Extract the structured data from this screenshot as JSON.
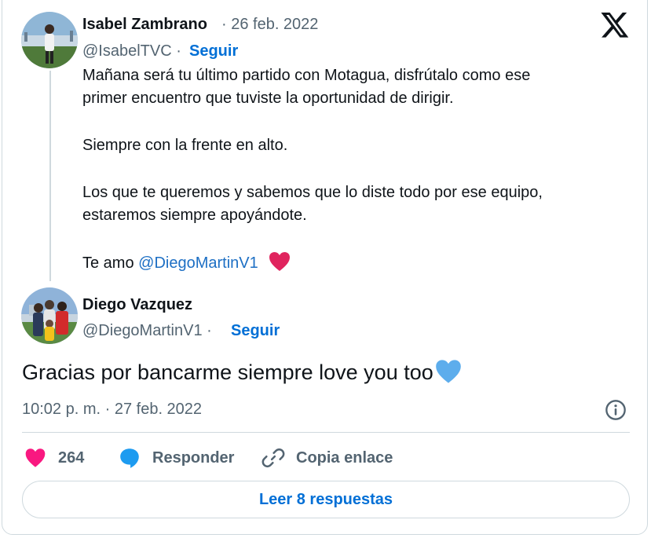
{
  "tweet_original": {
    "author_name": "Isabel Zambrano",
    "date": "· 26 feb. 2022",
    "handle": "@IsabelTVC ·",
    "follow_label": "Seguir",
    "lines": [
      "Mañana será tu último partido con Motagua, disfrútalo como ese",
      "primer encuentro que tuviste la oportunidad de dirigir.",
      "Siempre con la frente en alto.",
      "Los que te queremos y sabemos que lo diste todo por ese equipo,",
      "estaremos siempre apoyándote."
    ],
    "last_line_prefix": "Te amo",
    "mention": "@DiegoMartinV1",
    "heart_emoji": "❤️"
  },
  "tweet_reply": {
    "author_name": "Diego Vazquez",
    "handle": "@DiegoMartinV1 ·",
    "follow_label": "Seguir",
    "text": "Gracias por bancarme siempre love you too",
    "emoji": "💙",
    "timestamp": "10:02 p. m. · 27 feb. 2022"
  },
  "actions": {
    "like_count": "264",
    "reply_label": "Responder",
    "copy_label": "Copia enlace",
    "read_replies_label": "Leer 8 respuestas"
  },
  "icons": {
    "logo": "x-logo-icon",
    "info": "info-icon",
    "like": "heart-icon",
    "reply": "speech-bubble-icon",
    "copy": "link-icon"
  },
  "colors": {
    "link_blue": "#006fd6",
    "mention_blue": "#1d6fc4",
    "like_pink": "#f91880",
    "heart_red": "#e0245e",
    "blue_heart": "#5dadec",
    "secondary_text": "#536471",
    "border": "#cfd9de"
  }
}
